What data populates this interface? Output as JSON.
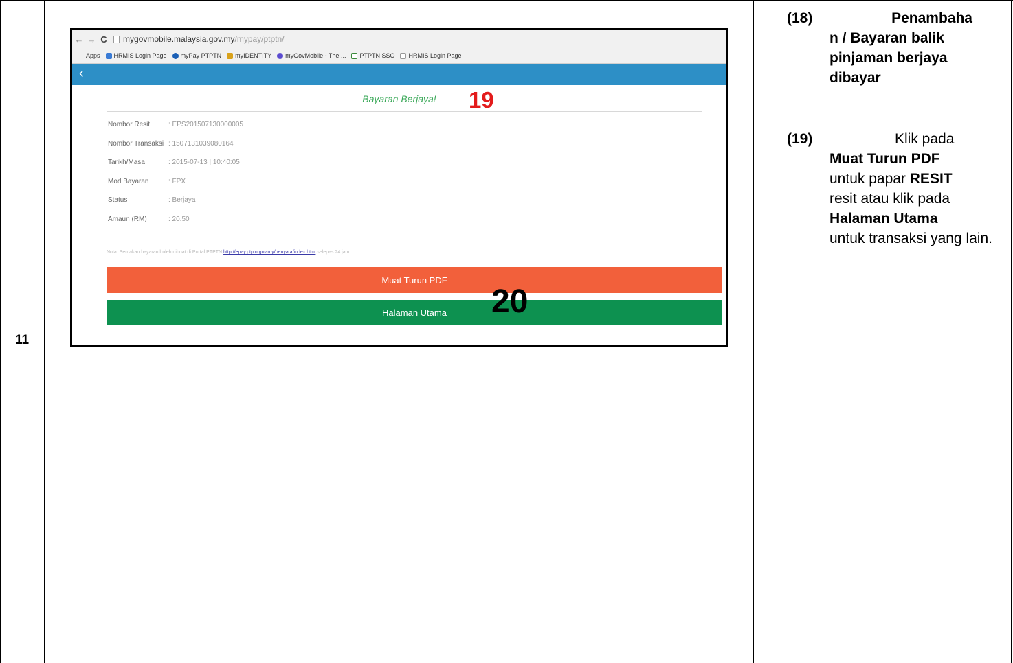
{
  "row": {
    "number": "11"
  },
  "screenshot": {
    "browser": {
      "back": "←",
      "forward": "→",
      "reload": "C",
      "url_host": "mygovmobile.malaysia.gov.my",
      "url_path": "/mypay/ptptn/"
    },
    "bookmarks": [
      {
        "label": "Apps",
        "icon": "apps-grid-icon"
      },
      {
        "label": "HRMIS Login Page",
        "icon": "hrmis-icon"
      },
      {
        "label": "myPay PTPTN",
        "icon": "mypay-icon"
      },
      {
        "label": "myIDENTITY",
        "icon": "myidentity-icon"
      },
      {
        "label": "myGovMobile - The ...",
        "icon": "mygovmobile-icon"
      },
      {
        "label": "PTPTN SSO",
        "icon": "ptptn-sso-icon"
      },
      {
        "label": "HRMIS Login Page",
        "icon": "page-icon"
      }
    ],
    "header": {
      "back_label": "‹"
    },
    "title": "Bayaran Berjaya!",
    "details": [
      {
        "label": "Nombor Resit",
        "value": ": EPS201507130000005"
      },
      {
        "label": "Nombor Transaksi",
        "value": ": 1507131039080164"
      },
      {
        "label": "Tarikh/Masa",
        "value": ": 2015-07-13 | 10:40:05"
      },
      {
        "label": "Mod Bayaran",
        "value": ": FPX"
      },
      {
        "label": "Status",
        "value": ": Berjaya"
      },
      {
        "label": "Amaun (RM)",
        "value": ": 20.50"
      }
    ],
    "note": {
      "prefix": "Nota: Semakan bayaran boleh dibuat di Portal PTPTN ",
      "link": "http://epay.ptptn.gov.my/penyata/index.html",
      "suffix": " selepas 24 jam."
    },
    "buttons": {
      "pdf": "Muat Turun PDF",
      "home": "Halaman Utama"
    },
    "markers": {
      "m19": "19",
      "m20": "20"
    }
  },
  "instructions": {
    "step18": {
      "number": "(18)",
      "text": "Penambahan / Bayaran balik pinjaman berjaya dibayar"
    },
    "step19": {
      "number": "(19)",
      "t1": "Klik pada",
      "b1": "Muat Turun PDF",
      "t2": "untuk papar",
      "b2": "RESIT",
      "t3": "resit atau klik pada",
      "b3": "Halaman Utama",
      "t4": "untuk transaksi yang lain."
    }
  },
  "colors": {
    "header_blue": "#2d8fc6",
    "pdf_button": "#f2603b",
    "home_button": "#0d9150",
    "title_green": "#3aa858",
    "marker_red": "#e31b1b"
  }
}
